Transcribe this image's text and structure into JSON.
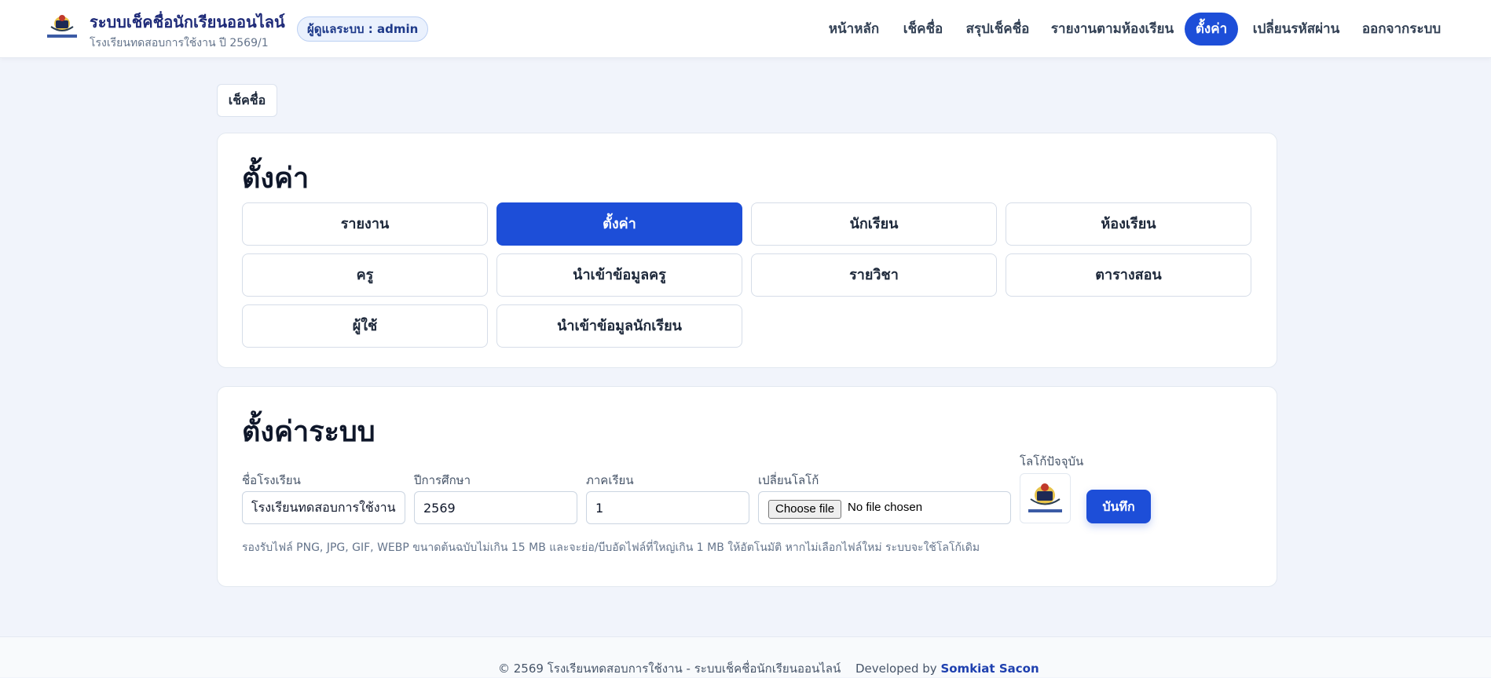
{
  "header": {
    "title": "ระบบเช็คชื่อนักเรียนออนไลน์",
    "subtitle": "โรงเรียนทดสอบการใช้งาน ปี 2569/1",
    "admin_badge": "ผู้ดูแลระบบ : admin",
    "nav": [
      {
        "label": "หน้าหลัก"
      },
      {
        "label": "เช็คชื่อ"
      },
      {
        "label": "สรุปเช็คชื่อ"
      },
      {
        "label": "รายงานตามห้องเรียน"
      },
      {
        "label": "ตั้งค่า",
        "active": true
      },
      {
        "label": "เปลี่ยนรหัสผ่าน"
      },
      {
        "label": "ออกจากระบบ"
      }
    ]
  },
  "breadcrumb": {
    "label": "เช็คชื่อ"
  },
  "settings_menu": {
    "title": "ตั้งค่า",
    "items": [
      {
        "label": "รายงาน"
      },
      {
        "label": "ตั้งค่า",
        "active": true
      },
      {
        "label": "นักเรียน"
      },
      {
        "label": "ห้องเรียน"
      },
      {
        "label": "ครู"
      },
      {
        "label": "นำเข้าข้อมูลครู"
      },
      {
        "label": "รายวิชา"
      },
      {
        "label": "ตารางสอน"
      },
      {
        "label": "ผู้ใช้"
      },
      {
        "label": "นำเข้าข้อมูลนักเรียน"
      }
    ]
  },
  "system_settings": {
    "title": "ตั้งค่าระบบ",
    "school_name_label": "ชื่อโรงเรียน",
    "school_name_value": "โรงเรียนทดสอบการใช้งาน",
    "academic_year_label": "ปีการศึกษา",
    "academic_year_value": "2569",
    "semester_label": "ภาคเรียน",
    "semester_value": "1",
    "change_logo_label": "เปลี่ยนโลโก้",
    "file_button": "Choose file",
    "file_status": "No file chosen",
    "current_logo_label": "โลโก้ปัจจุบัน",
    "save_button": "บันทึก",
    "hint": "รองรับไฟล์ PNG, JPG, GIF, WEBP ขนาดต้นฉบับไม่เกิน 15 MB และจะย่อ/บีบอัดไฟล์ที่ใหญ่เกิน 1 MB ให้อัตโนมัติ หากไม่เลือกไฟล์ใหม่ ระบบจะใช้โลโก้เดิม"
  },
  "footer": {
    "copyright": "© 2569 โรงเรียนทดสอบการใช้งาน - ระบบเช็คชื่อนักเรียนออนไลน์",
    "developed_by": "Developed by",
    "developer": "Somkiat Sacon"
  },
  "colors": {
    "accent": "#1d4ed8",
    "brand_text": "#1e2a78",
    "page_bg": "#f1f4fb"
  }
}
